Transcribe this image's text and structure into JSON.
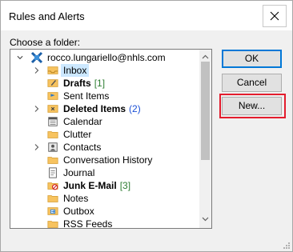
{
  "dialog": {
    "title": "Rules and Alerts",
    "choose_label": "Choose a folder:"
  },
  "tree": {
    "account": "rocco.lungariello@nhls.com",
    "items": [
      {
        "label": "Inbox",
        "icon": "inbox-folder-icon",
        "bold": false,
        "count": "",
        "count_color": "",
        "expandable": true,
        "selected": true
      },
      {
        "label": "Drafts",
        "icon": "drafts-folder-icon",
        "bold": true,
        "count": "[1]",
        "count_color": "#2e7d32",
        "expandable": false,
        "selected": false
      },
      {
        "label": "Sent Items",
        "icon": "sent-items-icon",
        "bold": false,
        "count": "",
        "count_color": "",
        "expandable": false,
        "selected": false
      },
      {
        "label": "Deleted Items",
        "icon": "deleted-items-icon",
        "bold": true,
        "count": "(2)",
        "count_color": "#1a4fd6",
        "expandable": true,
        "selected": false
      },
      {
        "label": "Calendar",
        "icon": "calendar-icon",
        "bold": false,
        "count": "",
        "count_color": "",
        "expandable": false,
        "selected": false
      },
      {
        "label": "Clutter",
        "icon": "folder-icon",
        "bold": false,
        "count": "",
        "count_color": "",
        "expandable": false,
        "selected": false
      },
      {
        "label": "Contacts",
        "icon": "contacts-icon",
        "bold": false,
        "count": "",
        "count_color": "",
        "expandable": true,
        "selected": false
      },
      {
        "label": "Conversation History",
        "icon": "folder-icon",
        "bold": false,
        "count": "",
        "count_color": "",
        "expandable": false,
        "selected": false
      },
      {
        "label": "Journal",
        "icon": "journal-icon",
        "bold": false,
        "count": "",
        "count_color": "",
        "expandable": false,
        "selected": false
      },
      {
        "label": "Junk E-Mail",
        "icon": "junk-email-icon",
        "bold": true,
        "count": "[3]",
        "count_color": "#2e7d32",
        "expandable": false,
        "selected": false
      },
      {
        "label": "Notes",
        "icon": "notes-icon",
        "bold": false,
        "count": "",
        "count_color": "",
        "expandable": false,
        "selected": false
      },
      {
        "label": "Outbox",
        "icon": "outbox-icon",
        "bold": false,
        "count": "",
        "count_color": "",
        "expandable": false,
        "selected": false
      },
      {
        "label": "RSS Feeds",
        "icon": "rss-feeds-icon",
        "bold": false,
        "count": "",
        "count_color": "",
        "expandable": false,
        "selected": false
      }
    ]
  },
  "buttons": {
    "ok": "OK",
    "cancel": "Cancel",
    "new": "New..."
  },
  "colors": {
    "selection": "#cce8ff",
    "highlight_border": "#e31c2d",
    "default_button_border": "#0078d7"
  }
}
